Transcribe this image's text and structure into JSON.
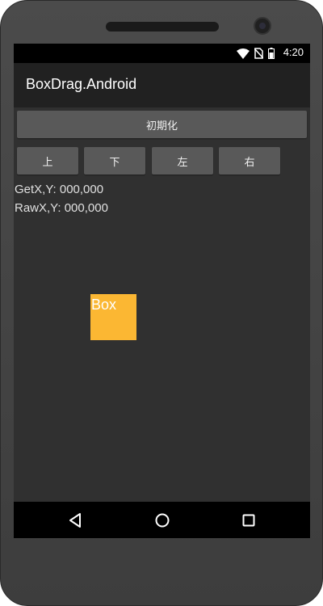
{
  "status_bar": {
    "time": "4:20",
    "icons": [
      "wifi-icon",
      "no-sim-icon",
      "battery-icon"
    ]
  },
  "app_bar": {
    "title": "BoxDrag.Android"
  },
  "buttons": {
    "init_label": "初期化",
    "up_label": "上",
    "down_label": "下",
    "left_label": "左",
    "right_label": "右"
  },
  "info": {
    "getxy": "GetX,Y: 000,000",
    "rawxy": "RawX,Y: 000,000"
  },
  "box": {
    "label": "Box",
    "color": "#fbb733"
  },
  "nav_bar": {
    "icons": [
      "back-icon",
      "home-icon",
      "recents-icon"
    ]
  },
  "colors": {
    "background": "#303030",
    "app_bar": "#212121",
    "button": "#595959"
  }
}
